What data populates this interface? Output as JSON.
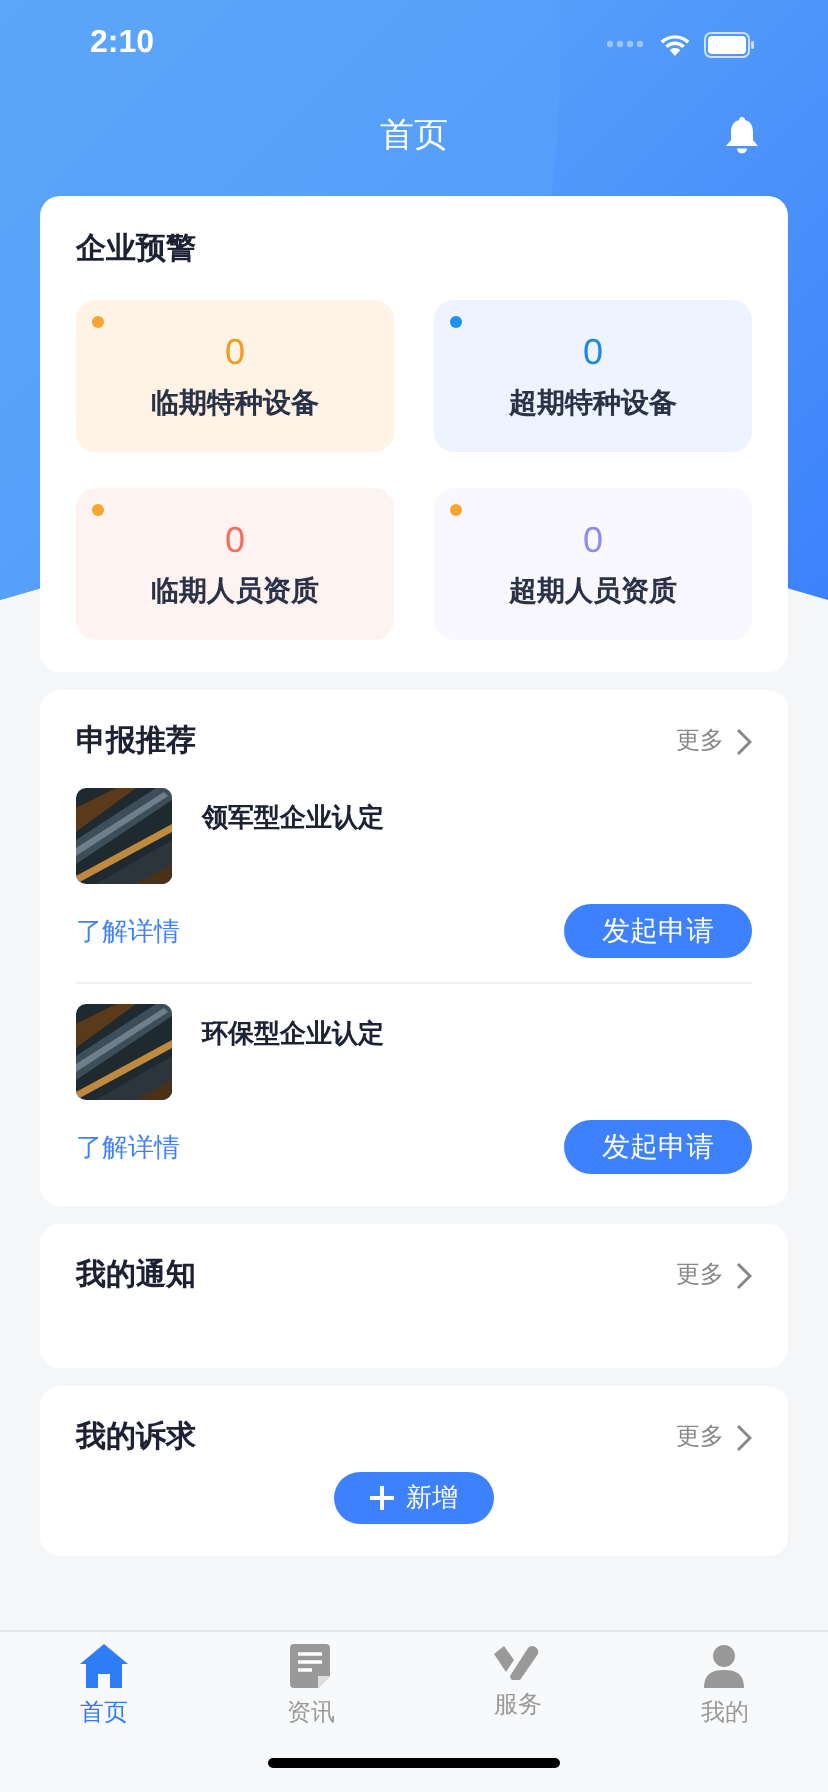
{
  "status_bar": {
    "time": "2:10"
  },
  "nav": {
    "title": "首页"
  },
  "alerts": {
    "title": "企业预警",
    "items": [
      {
        "count": "0",
        "label": "临期特种设备",
        "color": "#f7a531"
      },
      {
        "count": "0",
        "label": "超期特种设备",
        "color": "#1e90f0"
      },
      {
        "count": "0",
        "label": "临期人员资质",
        "color": "#f7a531"
      },
      {
        "count": "0",
        "label": "超期人员资质",
        "color": "#f7a531"
      }
    ]
  },
  "recommend": {
    "title": "申报推荐",
    "more": "更多",
    "items": [
      {
        "kind": "picture",
        "title": "领军型企业认定",
        "link": "了解详情",
        "action": "发起申请"
      },
      {
        "kind": "picture",
        "title": "环保型企业认定",
        "link": "了解详情",
        "action": "发起申请"
      }
    ]
  },
  "notices": {
    "title": "我的通知",
    "more": "更多"
  },
  "appeals": {
    "title": "我的诉求",
    "more": "更多",
    "add": "新增"
  },
  "tabs": [
    {
      "label": "首页",
      "selected": true
    },
    {
      "label": "资讯",
      "selected": false
    },
    {
      "label": "服务",
      "selected": false
    },
    {
      "label": "我的",
      "selected": false
    }
  ]
}
